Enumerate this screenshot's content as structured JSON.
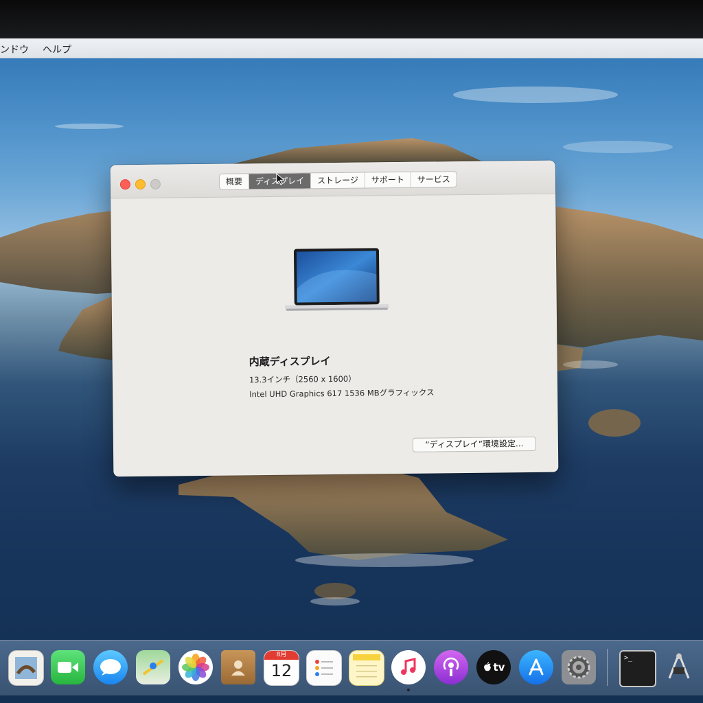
{
  "menubar": {
    "items": [
      "ンドウ",
      "ヘルプ"
    ]
  },
  "window": {
    "tabs": [
      {
        "label": "概要",
        "active": false
      },
      {
        "label": "ディスプレイ",
        "active": true
      },
      {
        "label": "ストレージ",
        "active": false
      },
      {
        "label": "サポート",
        "active": false
      },
      {
        "label": "サービス",
        "active": false
      }
    ],
    "display_name": "内蔵ディスプレイ",
    "display_size": "13.3インチ（2560 x 1600）",
    "graphics": "Intel UHD Graphics 617 1536 MBグラフィックス",
    "prefs_button": "“ディスプレイ”環境設定..."
  },
  "dock": {
    "calendar_month": "8月",
    "calendar_day": "12",
    "tv_label": "tv",
    "terminal_prompt": ">_",
    "icons": [
      "preview-icon",
      "facetime-icon",
      "messages-icon",
      "maps-icon",
      "photos-icon",
      "contacts-icon",
      "calendar-icon",
      "reminders-icon",
      "notes-icon",
      "music-icon",
      "podcasts-icon",
      "apple-tv-icon",
      "app-store-icon",
      "system-preferences-icon",
      "terminal-icon",
      "system-information-icon"
    ]
  },
  "colors": {
    "close": "#fe5f57",
    "minimize": "#febc2e",
    "zoom_disabled": "#cdcbc8",
    "tab_active": "#6b6b6b"
  }
}
